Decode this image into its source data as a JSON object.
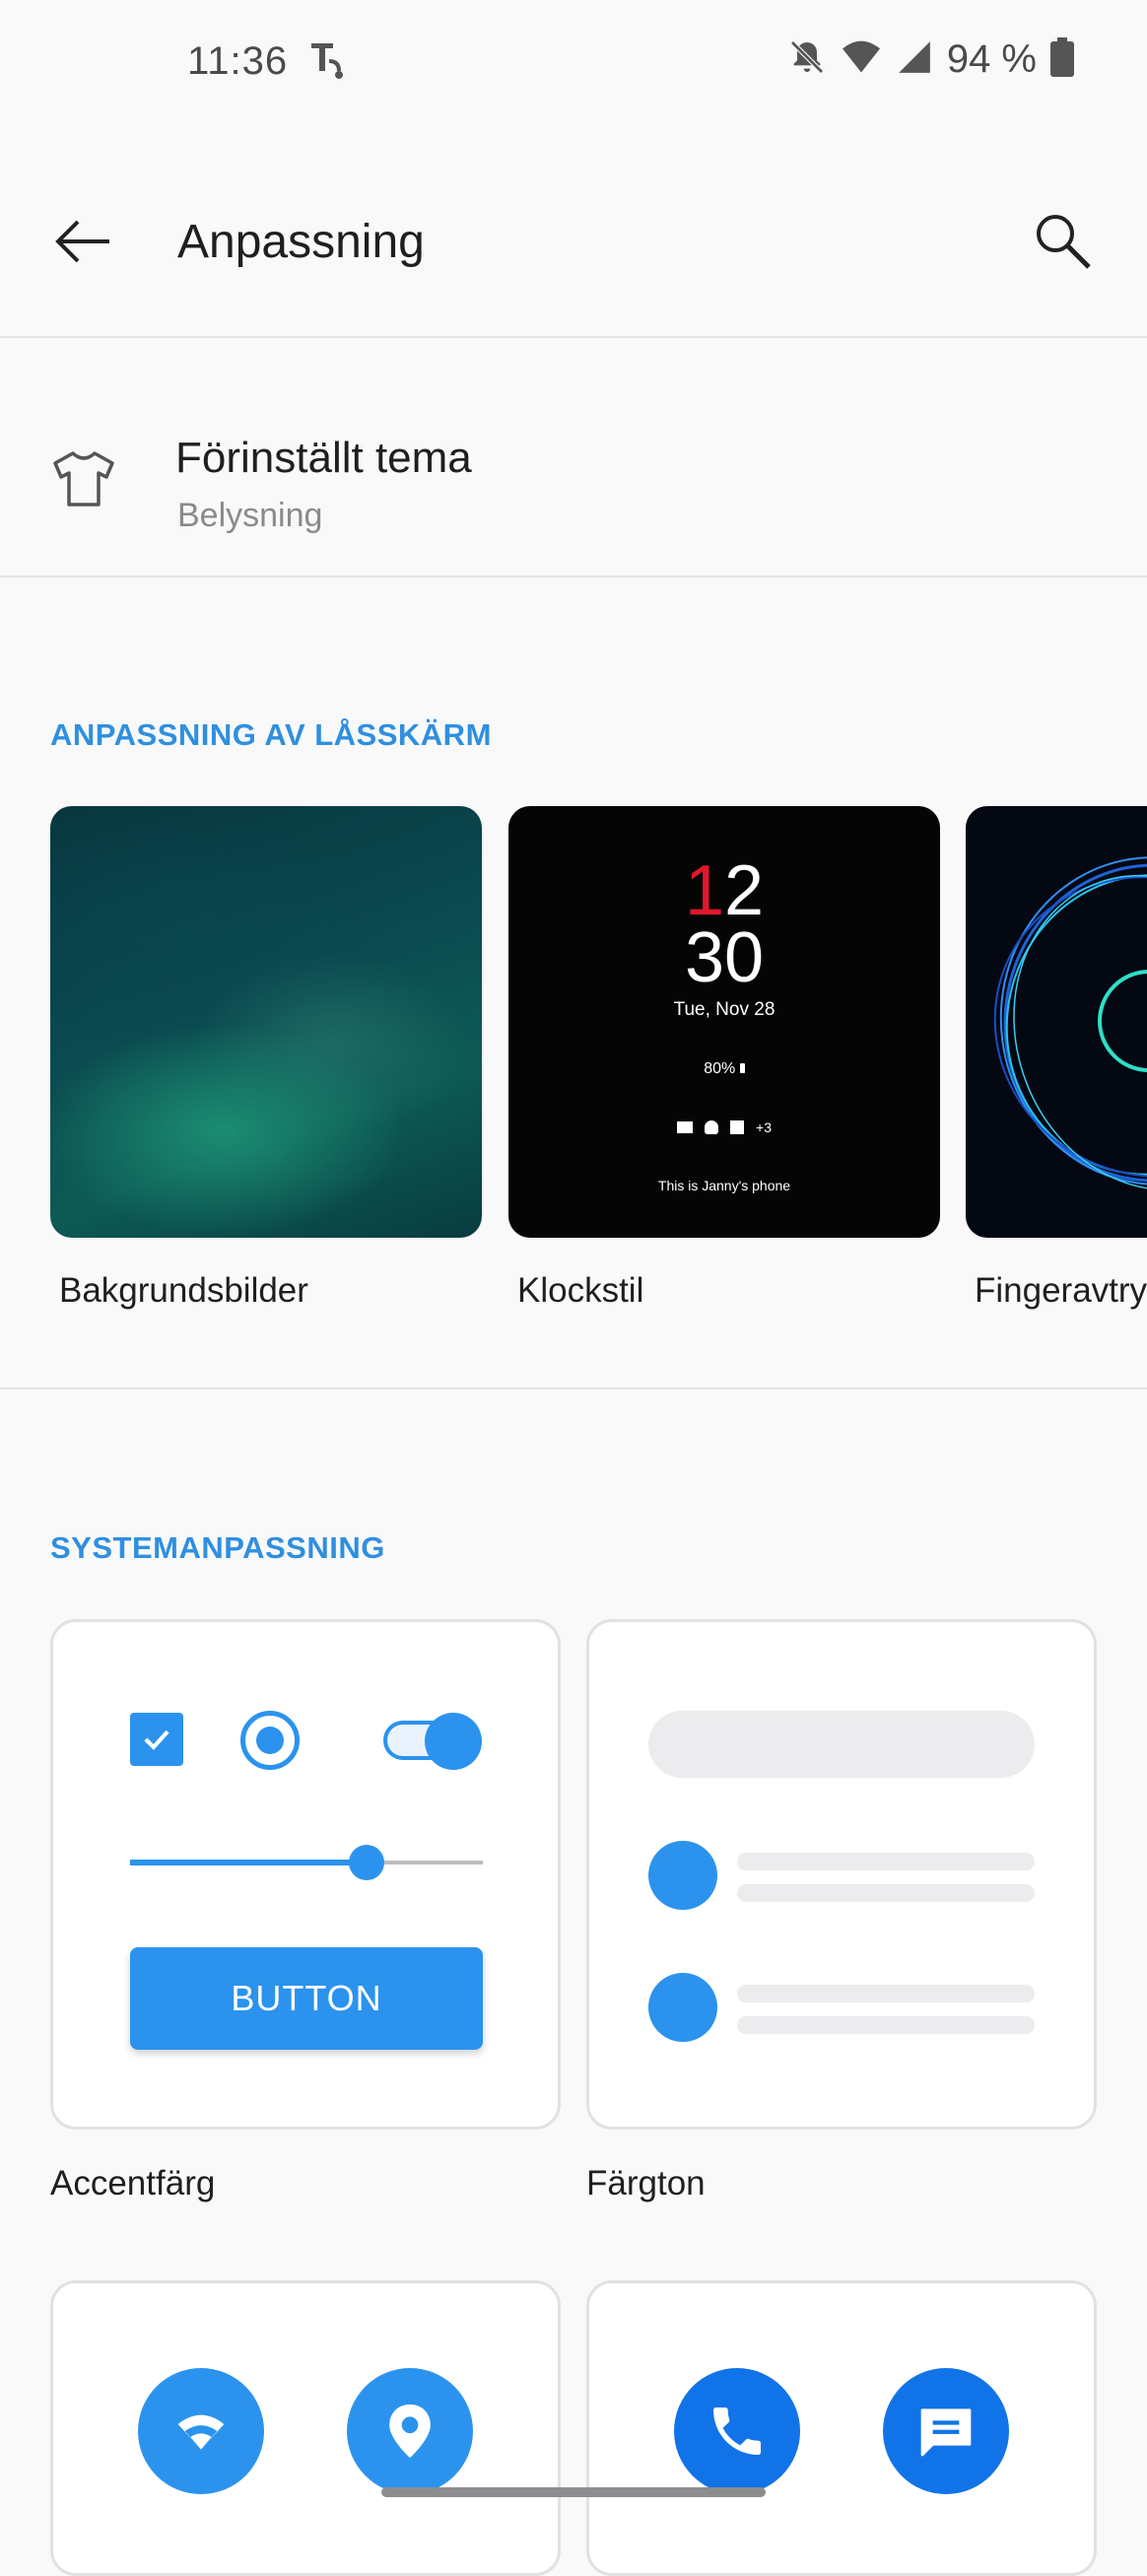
{
  "status_bar": {
    "time": "11:36",
    "battery_text": "94 %"
  },
  "app_bar": {
    "title": "Anpassning"
  },
  "theme": {
    "title": "Förinställt tema",
    "subtitle": "Belysning"
  },
  "lockscreen": {
    "header": "ANPASSNING AV LÅSSKÄRM",
    "cards": [
      {
        "label": "Bakgrundsbilder"
      },
      {
        "label": "Klockstil"
      },
      {
        "label": "Fingeravtry"
      }
    ],
    "clock_preview": {
      "hour_first_digit": "1",
      "hour_second_digit": "2",
      "minutes": "30",
      "date": "Tue, Nov 28",
      "battery": "80%",
      "notification_more": "+3",
      "owner_text": "This is Janny's phone"
    }
  },
  "system": {
    "header": "SYSTEMANPASSNING",
    "accent": {
      "label": "Accentfärg",
      "button_text": "BUTTON",
      "slider_value": 0.67
    },
    "tone": {
      "label": "Färgton"
    }
  },
  "colors": {
    "accent": "#2b93ee",
    "header": "#2f8fe0",
    "background": "#f9f9fa"
  }
}
